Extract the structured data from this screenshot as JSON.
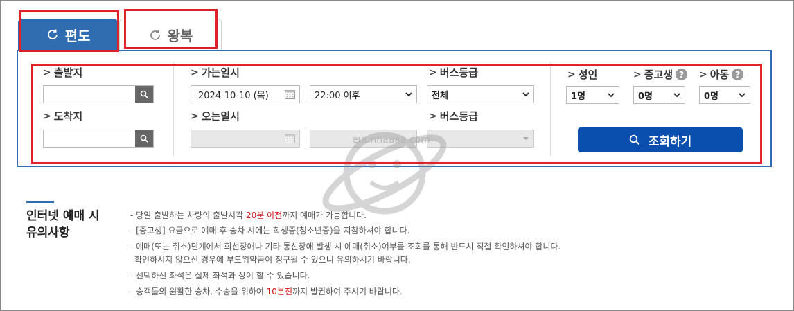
{
  "tabs": {
    "oneway": "편도",
    "roundtrip": "왕복"
  },
  "fields": {
    "departure": {
      "label": "출발지",
      "value": ""
    },
    "arrival": {
      "label": "도착지",
      "value": ""
    },
    "depart_date": {
      "label": "가는일시",
      "date": "2024-10-10 (목)",
      "time": "22:00 이후"
    },
    "return_date": {
      "label": "오는일시",
      "date": "",
      "time": ""
    },
    "bus_grade": {
      "label": "버스등급",
      "value": "전체"
    },
    "bus_grade_return": {
      "label": "버스등급",
      "value": ""
    },
    "adult": {
      "label": "성인",
      "value": "1명"
    },
    "student": {
      "label": "중고생",
      "value": "0명"
    },
    "child": {
      "label": "아동",
      "value": "0명"
    }
  },
  "search_button": "조회하기",
  "watermark": "euunhaaaa.com",
  "notice": {
    "title_line1": "인터넷 예매 시",
    "title_line2": "유의사항",
    "items": [
      {
        "pre": "- 당일 출발하는 차량의 출발시각 ",
        "hl": "20분 이전",
        "post": "까지 예매가 가능합니다."
      },
      {
        "pre": "- [중고생] 요금으로 예매 후 승차 시에는 학생증(청소년증)을 지참하셔야 합니다.",
        "hl": "",
        "post": ""
      },
      {
        "pre": "- 예매(또는 취소)단계에서 회선장애나 기타 통신장애 발생 시 예매(취소)여부를 조회를 통해 반드시 직접 확인하셔야 합니다.",
        "hl": "",
        "post": ""
      },
      {
        "pre": "  확인하시지 않으신 경우에 부도위약금이 청구될 수 있으니 유의하시기 바랍니다.",
        "hl": "",
        "post": ""
      },
      {
        "pre": "- 선택하신 좌석은 실제 좌석과 상이 할 수 있습니다.",
        "hl": "",
        "post": ""
      },
      {
        "pre": "- 승객들의 원활한 승차, 수송을 위하여 ",
        "hl": "10분전",
        "post": "까지 발권하여 주시기 바랍니다."
      }
    ]
  },
  "colors": {
    "primary": "#2f6db0",
    "button": "#0b4fae",
    "highlight_box": "#e0202a",
    "notice_highlight": "#d01515"
  },
  "icons": [
    "refresh-icon",
    "search-icon",
    "calendar-icon",
    "chevron-down-icon",
    "help-icon"
  ]
}
